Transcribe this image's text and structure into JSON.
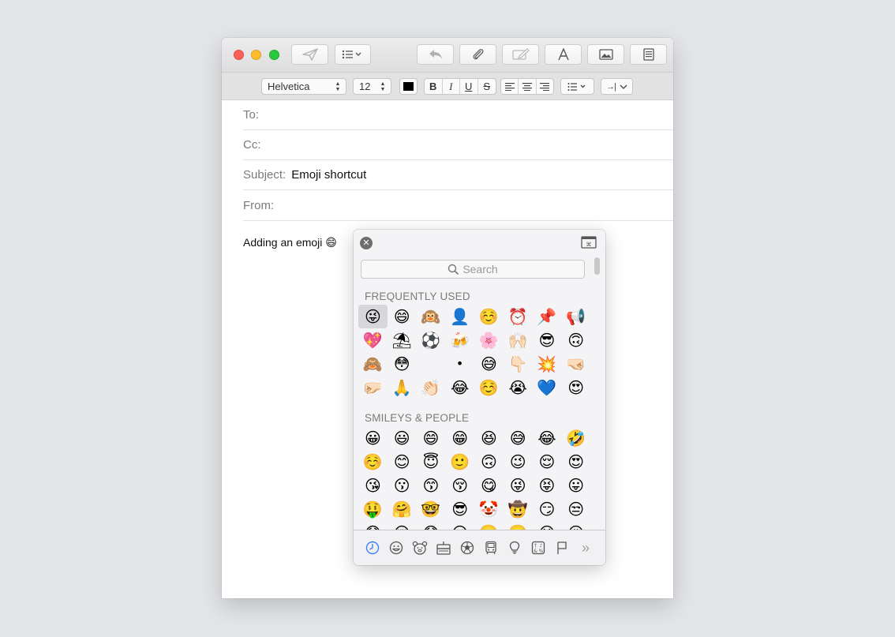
{
  "toolbar": {
    "font_family": "Helvetica",
    "font_size": "12",
    "text_color": "#000000",
    "bold": "B",
    "italic": "I",
    "underline": "U",
    "strike": "S",
    "indent_glyph": "→|"
  },
  "message": {
    "to_label": "To:",
    "cc_label": "Cc:",
    "subject_label": "Subject:",
    "subject_value": "Emoji shortcut",
    "from_label": "From:",
    "body": "Adding an emoji 😄"
  },
  "picker": {
    "search_placeholder": "Search",
    "close_glyph": "✕",
    "frequently_used_title": "FREQUENTLY USED",
    "frequently_used": [
      "😜",
      "😄",
      "🙉",
      "👤",
      "☺️",
      "⏰",
      "📌",
      "📢",
      "💖",
      "⛱",
      "⚽",
      "🍻",
      "🌸",
      "🙌🏻",
      "😎",
      "🙃",
      "🙈",
      "😳",
      "",
      "•",
      "😅",
      "👇🏻",
      "💥",
      "🤜🏻",
      "🤛🏻",
      "🙏",
      "👏🏻",
      "😂",
      "☺️",
      "😭",
      "💙",
      "😍"
    ],
    "smileys_title": "SMILEYS & PEOPLE",
    "smileys": [
      "😀",
      "😃",
      "😄",
      "😁",
      "😆",
      "😅",
      "😂",
      "🤣",
      "☺️",
      "😊",
      "😇",
      "🙂",
      "🙃",
      "😉",
      "😌",
      "😍",
      "😘",
      "😗",
      "😙",
      "😚",
      "😋",
      "😜",
      "😝",
      "😛",
      "🤑",
      "🤗",
      "🤓",
      "😎",
      "🤡",
      "🤠",
      "😏",
      "😒",
      "😞",
      "😔",
      "😟",
      "😕",
      "🙁",
      "☹️",
      "😣",
      "😖"
    ],
    "categories": [
      "recent-icon",
      "smiley-icon",
      "animal-icon",
      "food-icon",
      "activity-icon",
      "travel-icon",
      "objects-icon",
      "symbols-icon",
      "flags-icon",
      "more-icon"
    ],
    "more_glyph": "»"
  },
  "colors": {
    "accent": "#3b82f6",
    "close_red": "#fc5f57",
    "minimize_yellow": "#fdbc2e",
    "zoom_green": "#28c83f"
  }
}
